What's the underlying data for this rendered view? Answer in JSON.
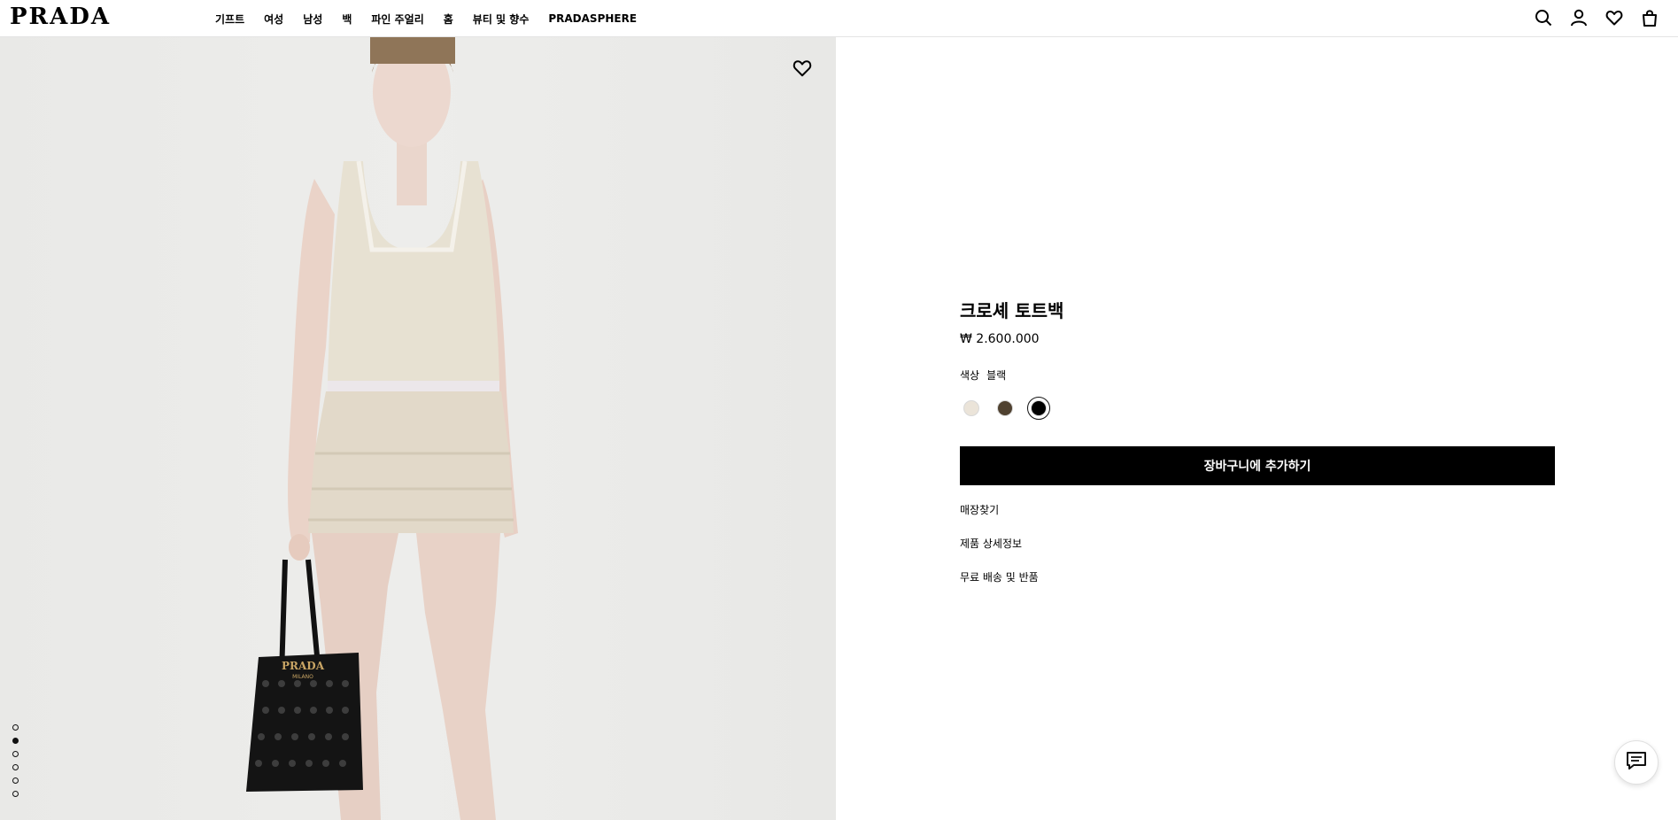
{
  "header": {
    "logo": "PRADA",
    "nav": [
      "기프트",
      "여성",
      "남성",
      "백",
      "파인 주얼리",
      "홈",
      "뷰티 및 향수",
      "PRADASPHERE"
    ],
    "icons": [
      "search-icon",
      "account-icon",
      "wishlist-icon",
      "bag-icon"
    ]
  },
  "gallery": {
    "image_count": 6,
    "active_index": 1,
    "bag_logo": "PRADA",
    "bag_logo_sub": "MILANO"
  },
  "product": {
    "title": "크로셰 토트백",
    "price": "₩ 2.600.000",
    "color_label": "색상",
    "color_value": "블랙",
    "swatches": [
      {
        "name": "ivory",
        "color": "#ebe4d9"
      },
      {
        "name": "brown",
        "color": "#4f4130"
      },
      {
        "name": "black",
        "color": "#000000",
        "selected": true
      }
    ],
    "add_to_cart": "장바구니에 추가하기",
    "links": [
      "매장찾기",
      "제품 상세정보",
      "무료 배송 및 반품"
    ]
  },
  "colors": {
    "accent": "#000000",
    "background_gallery": "#ebebe9"
  }
}
